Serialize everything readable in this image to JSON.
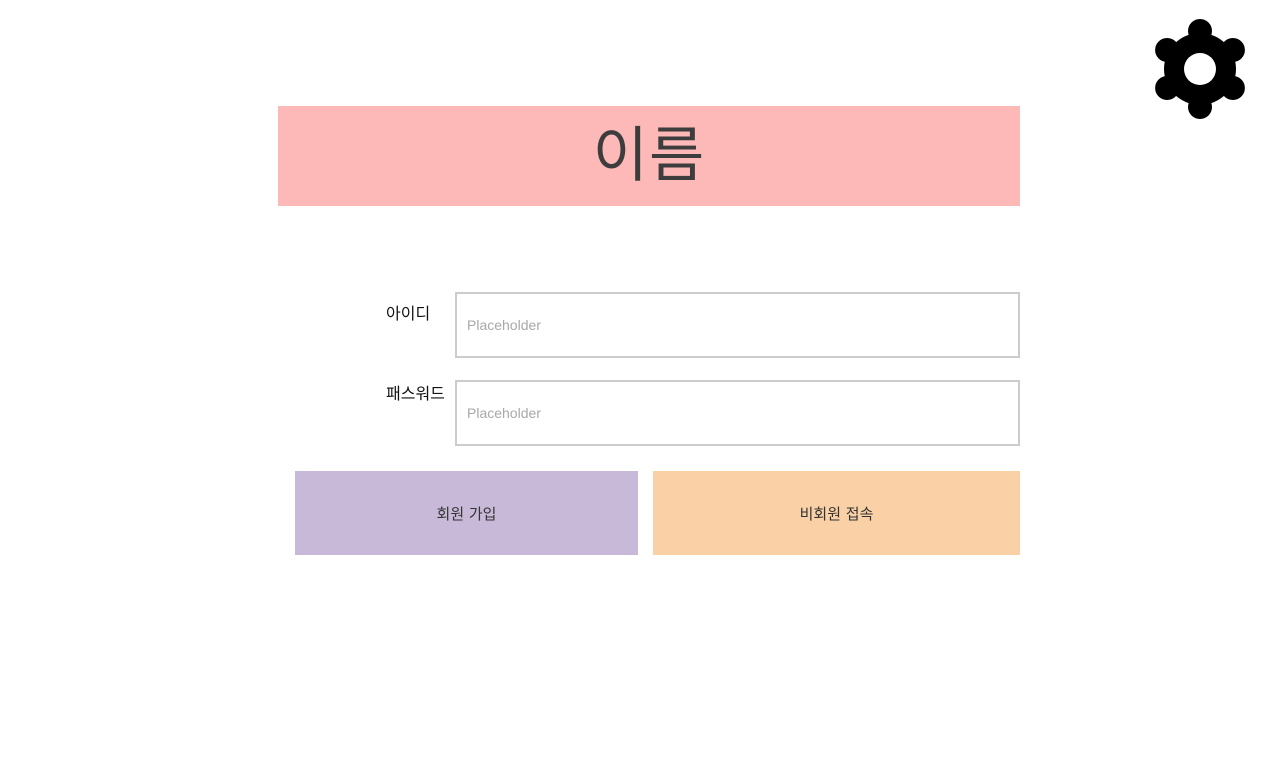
{
  "header": {
    "title": "이름",
    "banner_color": "#fdb8b8"
  },
  "settings": {
    "icon": "gear-icon"
  },
  "login_form": {
    "id_label": "아이디",
    "id_placeholder": "Placeholder",
    "id_value": "",
    "password_label": "패스워드",
    "password_placeholder": "Placeholder",
    "password_value": ""
  },
  "actions": {
    "signup_label": "회원 가입",
    "signup_color": "#c8b9d9",
    "guest_label": "비회원 접속",
    "guest_color": "#fad1a6"
  }
}
